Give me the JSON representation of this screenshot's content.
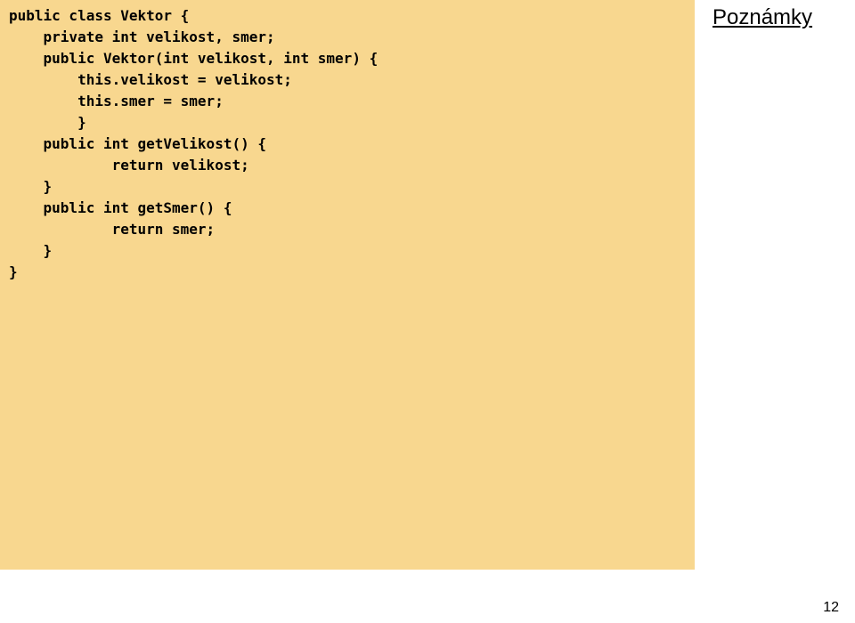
{
  "code": {
    "lines": [
      "public class Vektor {",
      "    private int velikost, smer;",
      "    public Vektor(int velikost, int smer) {",
      "        this.velikost = velikost;",
      "        this.smer = smer;",
      "        }",
      "    public int getVelikost() {",
      "            return velikost;",
      "    }",
      "    public int getSmer() {",
      "            return smer;",
      "    }",
      "}"
    ]
  },
  "sidebar": {
    "heading": "Poznámky"
  },
  "page": {
    "number": "12"
  }
}
